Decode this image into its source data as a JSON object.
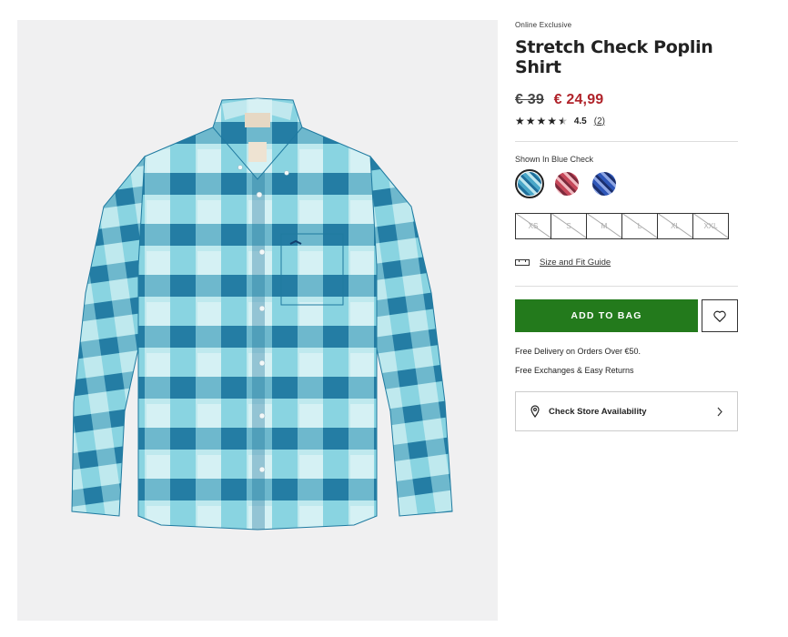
{
  "product": {
    "eyebrow": "Online Exclusive",
    "title": "Stretch Check Poplin Shirt",
    "price_original": "€ 39",
    "price_sale": "€ 24,99",
    "rating_value": "4.5",
    "review_count": "(2)",
    "rating_stars": 4.5,
    "image_icon": "plaid-shirt-image"
  },
  "color": {
    "label": "Shown In Blue Check",
    "swatches": [
      {
        "name": "Blue Check",
        "selected": true
      },
      {
        "name": "Red Check",
        "selected": false
      },
      {
        "name": "Navy Check",
        "selected": false
      }
    ]
  },
  "sizes": [
    "XS",
    "S",
    "M",
    "L",
    "XL",
    "XXL"
  ],
  "size_guide": {
    "label": "Size and Fit Guide",
    "icon": "ruler-icon"
  },
  "actions": {
    "add_to_bag": "ADD TO BAG",
    "wishlist_icon": "heart-icon"
  },
  "info": {
    "delivery": "Free Delivery on Orders Over €50.",
    "returns": "Free Exchanges & Easy Returns"
  },
  "store": {
    "label": "Check Store Availability",
    "icon": "map-pin-icon",
    "chevron": "chevron-right-icon"
  },
  "colors": {
    "accent_green": "#237a1c",
    "sale_red": "#b0232a",
    "image_bg": "#f0f0f1"
  }
}
